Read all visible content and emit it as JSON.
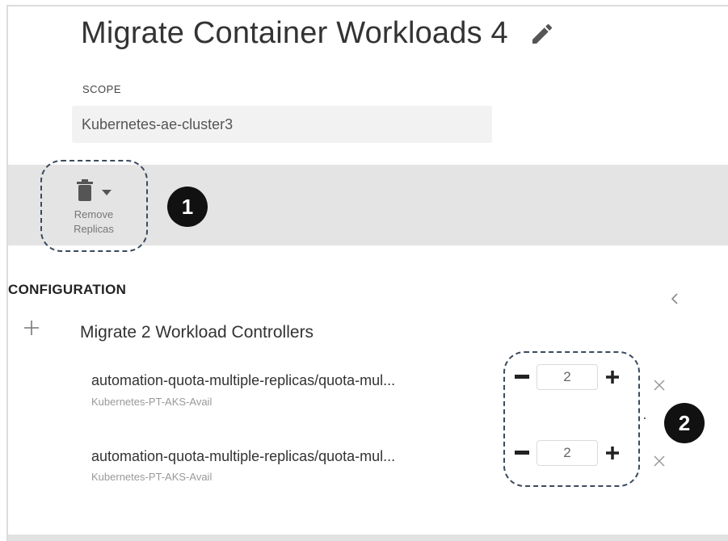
{
  "header": {
    "title": "Migrate Container Workloads 4",
    "edit_icon": "pencil-icon"
  },
  "scope": {
    "label": "SCOPE",
    "value": "Kubernetes-ae-cluster3"
  },
  "toolbar": {
    "remove_button": {
      "label_line1": "Remove",
      "label_line2": "Replicas",
      "icon": "trash-icon",
      "dropdown_icon": "caret-down-icon"
    },
    "callout_1": "1"
  },
  "configuration": {
    "title": "CONFIGURATION",
    "collapse_icon": "chevron-left-icon",
    "group": {
      "add_icon": "plus-icon",
      "label": "Migrate 2 Workload Controllers"
    },
    "items": [
      {
        "name": "automation-quota-multiple-replicas/quota-mul...",
        "cluster": "Kubernetes-PT-AKS-Avail",
        "replicas": "2"
      },
      {
        "name": "automation-quota-multiple-replicas/quota-mul...",
        "cluster": "Kubernetes-PT-AKS-Avail",
        "replicas": "2"
      }
    ],
    "callout_2": "2"
  },
  "colors": {
    "toolbar_bg": "#e4e4e4",
    "scope_bg": "#f2f2f2",
    "callout_bg": "#111111",
    "dashed_outline": "#3b4a5e"
  }
}
